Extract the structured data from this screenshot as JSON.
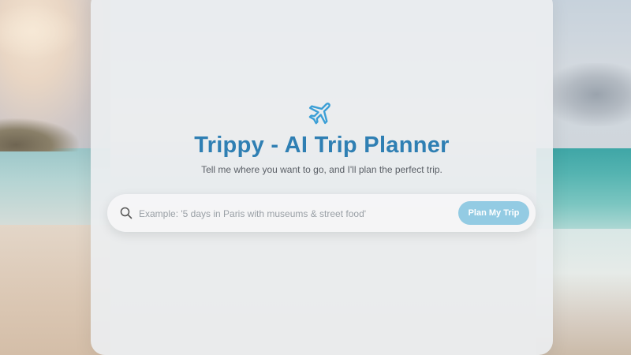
{
  "app": {
    "title": "Trippy - AI Trip Planner",
    "subtitle": "Tell me where you want to go, and I'll plan the perfect trip.",
    "logo_icon": "airplane-icon"
  },
  "search": {
    "icon": "search-icon",
    "placeholder": "Example: '5 days in Paris with museums & street food'",
    "value": "",
    "button_label": "Plan My Trip"
  },
  "colors": {
    "accent": "#2f7fb3",
    "icon": "#3b9fd6",
    "button": "#93cbe3"
  }
}
